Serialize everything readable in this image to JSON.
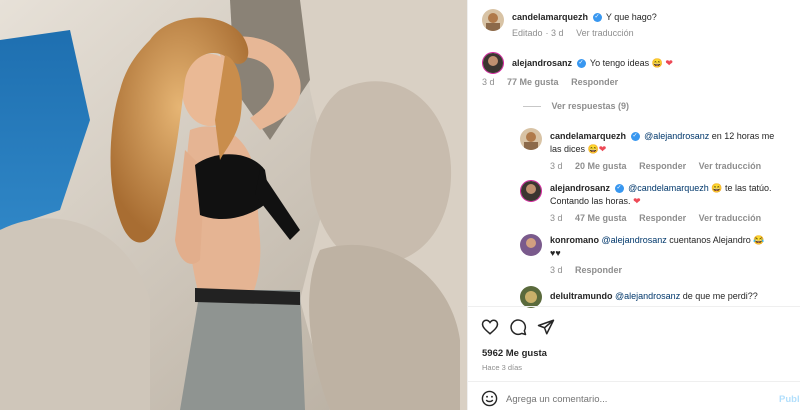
{
  "comments": [
    {
      "username": "candelamarquezh",
      "text": "Y que hago?",
      "meta": {
        "edited": "Editado",
        "time": "3 d",
        "translate": "Ver traducción"
      }
    },
    {
      "username": "alejandrosanz",
      "text": "Yo tengo ideas",
      "emoji": "😄",
      "heart": "❤",
      "meta": {
        "time": "3 d",
        "likes": "77 Me gusta",
        "reply": "Responder"
      },
      "view_replies": "Ver respuestas (9)"
    }
  ],
  "replies": [
    {
      "username": "candelamarquezh",
      "mention": "@alejandrosanz",
      "text_line1": " en 12 horas me",
      "text_line2": "las dices",
      "emoji": "😄",
      "heart": "❤",
      "meta": {
        "time": "3 d",
        "likes": "20 Me gusta",
        "reply": "Responder",
        "translate": "Ver traducción"
      }
    },
    {
      "username": "alejandrosanz",
      "mention": "@candelamarquezh",
      "text_line1": " te las tatúo.",
      "text_line2": "Contando las horas.",
      "emoji": "😄",
      "heart": "❤",
      "meta": {
        "time": "3 d",
        "likes": "47 Me gusta",
        "reply": "Responder",
        "translate": "Ver traducción"
      }
    },
    {
      "username": "konromano",
      "mention": "@alejandrosanz",
      "text_line1": " cuentanos Alejandro",
      "emoji": "😂",
      "text_line2": "♥♥",
      "meta": {
        "time": "3 d",
        "reply": "Responder"
      }
    },
    {
      "username": "delultramundo",
      "mention": "@alejandrosanz",
      "text_line1": " de que me perdi??"
    }
  ],
  "actions": {
    "like_icon": "heart-outline-icon",
    "comment_icon": "comment-icon",
    "share_icon": "send-icon"
  },
  "likes": "5962 Me gusta",
  "posted": "Hace 3 días",
  "composer": {
    "placeholder": "Agrega un comentario...",
    "post_label": "Publ"
  },
  "colors": {
    "verified": "#3897f0",
    "heart": "#ed4956",
    "mention": "#00376b",
    "meta": "#8e8e8e"
  }
}
